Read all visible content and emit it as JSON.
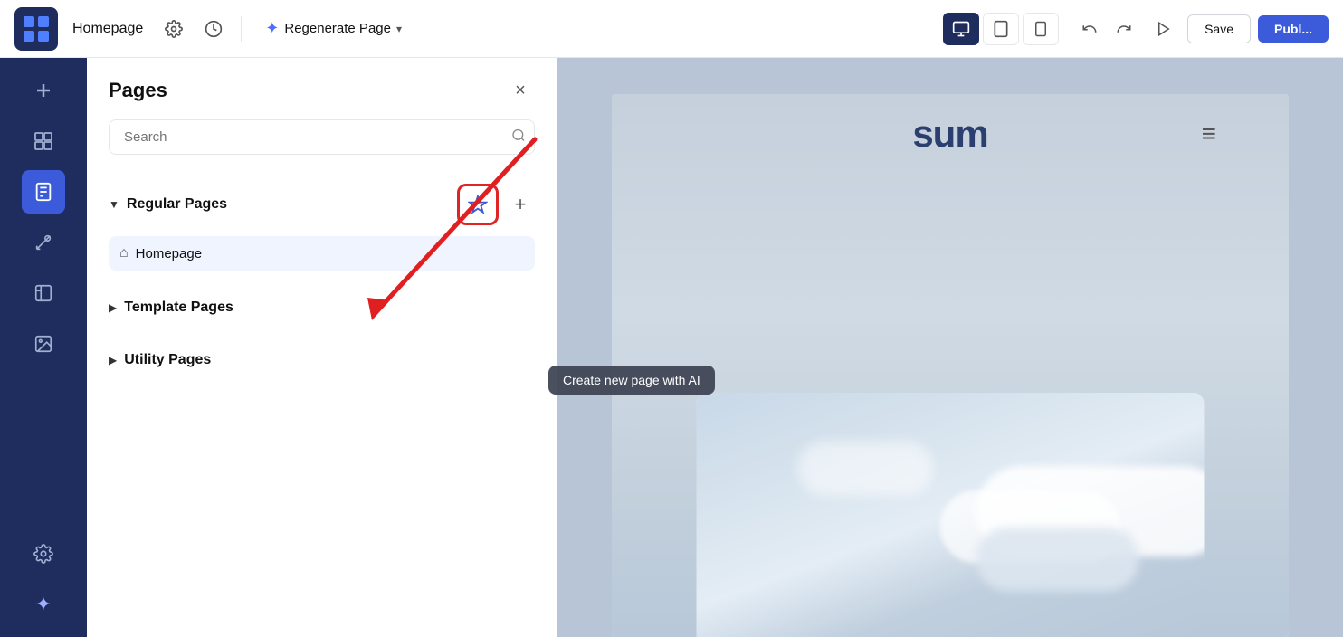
{
  "topbar": {
    "page_name": "Homepage",
    "regenerate_label": "Regenerate Page",
    "save_label": "Save",
    "publish_label": "Publ...",
    "view_desktop_label": "🖥",
    "view_tablet_label": "⊡",
    "view_mobile_label": "□"
  },
  "sidebar": {
    "items": [
      {
        "id": "add",
        "icon": "+",
        "label": "Add"
      },
      {
        "id": "widgets",
        "icon": "⊞",
        "label": "Widgets"
      },
      {
        "id": "pages",
        "icon": "📄",
        "label": "Pages"
      },
      {
        "id": "design",
        "icon": "✂",
        "label": "Design"
      },
      {
        "id": "media",
        "icon": "⊟",
        "label": "Media"
      },
      {
        "id": "image",
        "icon": "🖼",
        "label": "Image"
      },
      {
        "id": "settings",
        "icon": "⚙",
        "label": "Settings"
      },
      {
        "id": "ai",
        "icon": "✦",
        "label": "AI"
      }
    ]
  },
  "pages_panel": {
    "title": "Pages",
    "close_label": "×",
    "search_placeholder": "Search",
    "sections": [
      {
        "id": "regular",
        "title": "Regular Pages",
        "expanded": true,
        "pages": [
          {
            "id": "homepage",
            "name": "Homepage",
            "icon": "⌂"
          }
        ]
      },
      {
        "id": "template",
        "title": "Template Pages",
        "expanded": false,
        "pages": []
      },
      {
        "id": "utility",
        "title": "Utility Pages",
        "expanded": false,
        "pages": []
      }
    ],
    "ai_button_tooltip": "Create new page with AI",
    "ai_button_label": "✦",
    "add_button_label": "+"
  },
  "canvas": {
    "logo_text": "sum",
    "hamburger": "≡"
  },
  "tooltip": {
    "text": "Create new page with AI"
  }
}
